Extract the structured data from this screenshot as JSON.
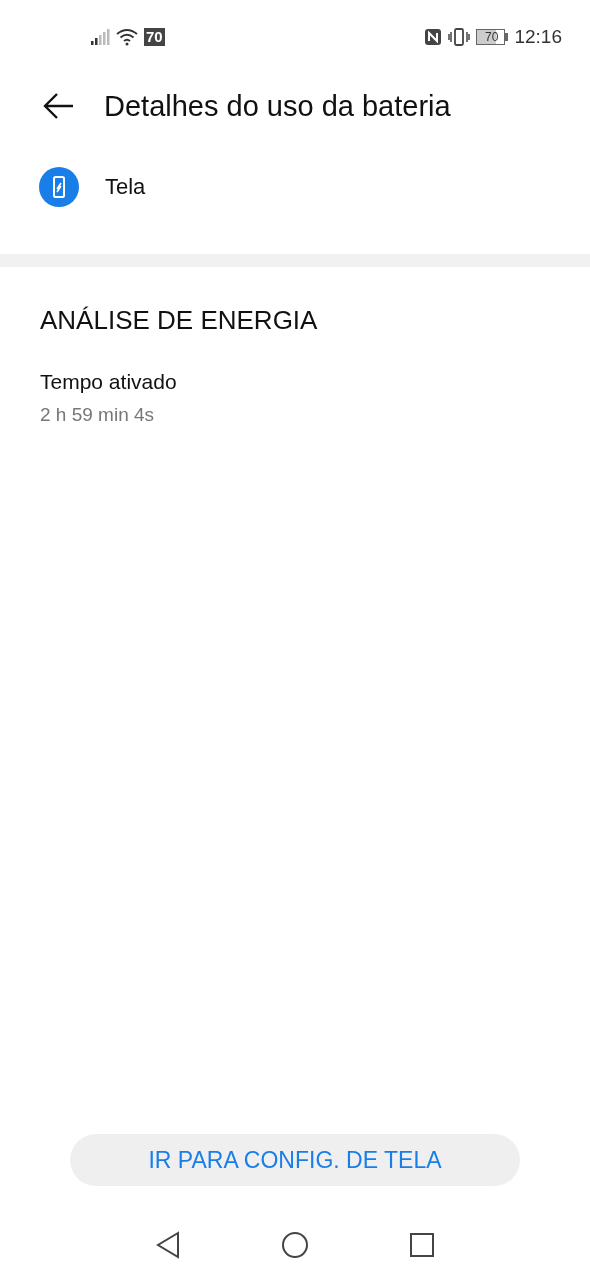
{
  "status_bar": {
    "network_badge": "70",
    "battery_text": "70",
    "time": "12:16"
  },
  "header": {
    "title": "Detalhes do uso da bateria"
  },
  "app_item": {
    "label": "Tela"
  },
  "section": {
    "title": "ANÁLISE DE ENERGIA",
    "rows": [
      {
        "label": "Tempo ativado",
        "value": "2 h 59 min 4s"
      }
    ]
  },
  "action_button": {
    "label": "IR PARA CONFIG. DE TELA"
  }
}
